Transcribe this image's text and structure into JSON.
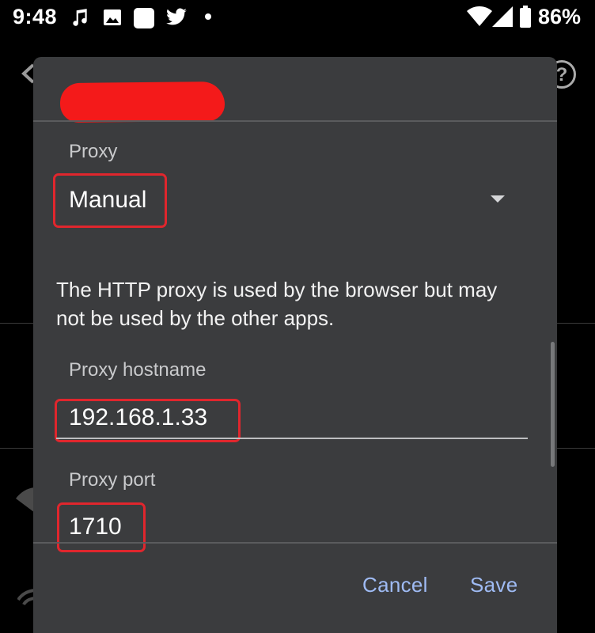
{
  "status_bar": {
    "time": "9:48",
    "battery_percent": "86%",
    "icons": [
      "music-note-icon",
      "image-icon",
      "app-square-icon",
      "twitter-icon",
      "dot-icon",
      "wifi-icon",
      "cell-signal-icon",
      "battery-icon"
    ]
  },
  "background": {
    "back_icon": "back-arrow-icon",
    "help_icon": "help-icon",
    "help_glyph": "?"
  },
  "dialog": {
    "title_redacted": true,
    "proxy_label": "Proxy",
    "proxy_value": "Manual",
    "note": "The HTTP proxy is used by the browser but may not be used by the other apps.",
    "hostname_label": "Proxy hostname",
    "hostname_value": "192.168.1.33",
    "port_label": "Proxy port",
    "port_value": "1710",
    "cancel_label": "Cancel",
    "save_label": "Save"
  },
  "colors": {
    "dialog_bg": "#3b3c3e",
    "accent_button": "#9fbbf4",
    "highlight_red": "#e0262d",
    "redaction_red": "#f41a1a"
  }
}
